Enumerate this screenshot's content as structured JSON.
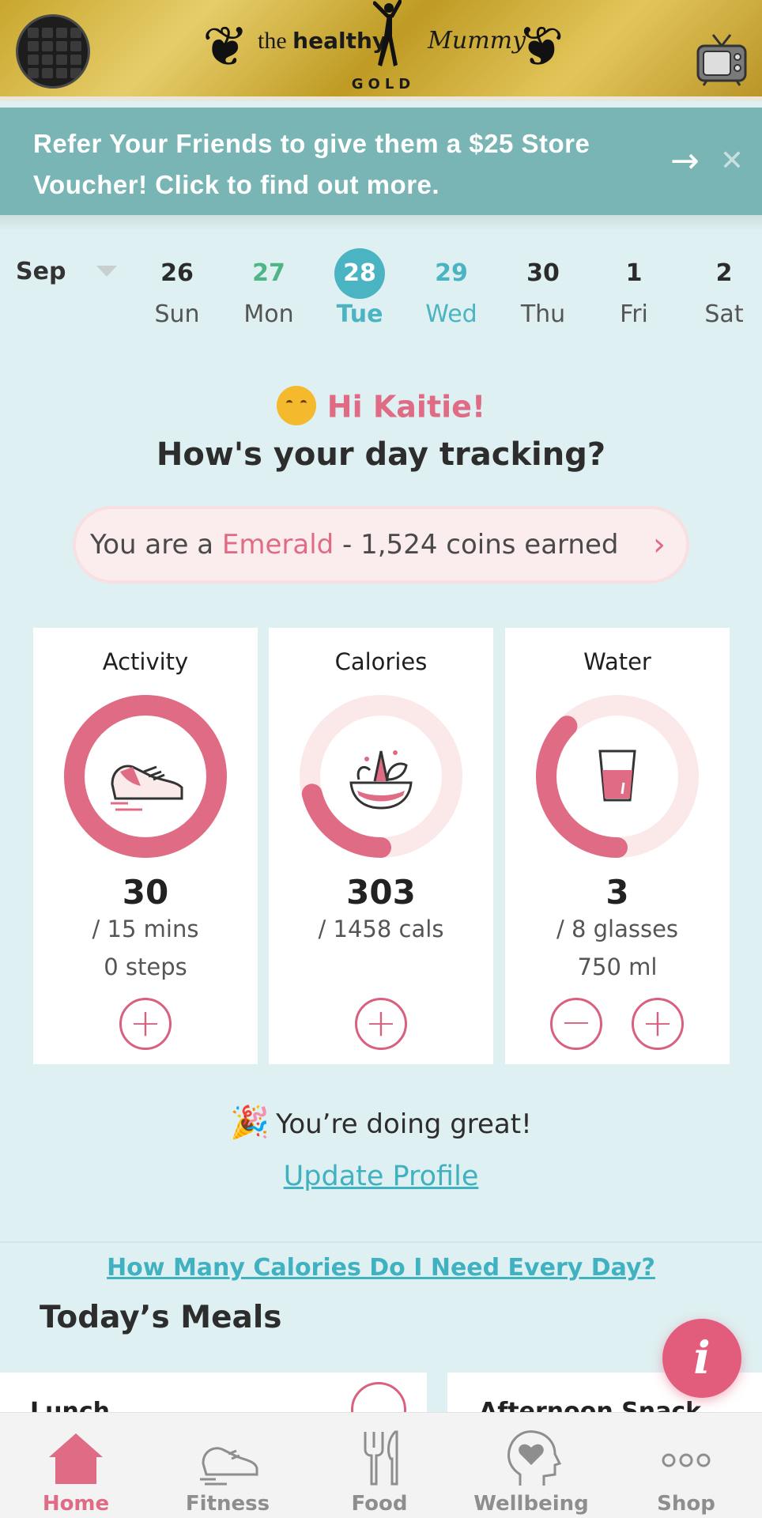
{
  "header": {
    "brand_prefix": "the",
    "brand_main": "healthy",
    "brand_script": "Mummy",
    "brand_tier": "GOLD"
  },
  "banner": {
    "text": "Refer Your Friends to give them a $25 Store Voucher! Click to find out more.",
    "arrow": "→",
    "close": "✕"
  },
  "calendar": {
    "month": "Sep",
    "days": [
      {
        "num": "26",
        "name": "Sun"
      },
      {
        "num": "27",
        "name": "Mon"
      },
      {
        "num": "28",
        "name": "Tue"
      },
      {
        "num": "29",
        "name": "Wed"
      },
      {
        "num": "30",
        "name": "Thu"
      },
      {
        "num": "1",
        "name": "Fri"
      },
      {
        "num": "2",
        "name": "Sat"
      }
    ]
  },
  "greeting": {
    "hi": "Hi Kaitie!",
    "question": "How's your day tracking?"
  },
  "rank": {
    "prefix": "You are a ",
    "level": "Emerald",
    "suffix": " - 1,524 coins earned",
    "chevron": "›"
  },
  "cards": {
    "activity": {
      "title": "Activity",
      "value": "30",
      "target": "/ 15 mins",
      "extra": "0 steps",
      "progress": 1.0
    },
    "calories": {
      "title": "Calories",
      "value": "303",
      "target": "/ 1458 cals",
      "progress": 0.21
    },
    "water": {
      "title": "Water",
      "value": "3",
      "target": "/ 8 glasses",
      "extra": "750 ml",
      "progress": 0.375
    }
  },
  "buttons": {
    "plus": "+",
    "minus": "−"
  },
  "status": {
    "text": "You’re doing great!"
  },
  "links": {
    "update_profile": "Update Profile",
    "calorie_help": "How Many Calories Do I Need Every Day?"
  },
  "meals": {
    "title": "Today’s Meals",
    "items": [
      "Lunch",
      "Afternoon Snack"
    ]
  },
  "info_button": "i",
  "tabs": [
    {
      "label": "Home",
      "icon": "home-icon"
    },
    {
      "label": "Fitness",
      "icon": "sneaker-icon"
    },
    {
      "label": "Food",
      "icon": "fork-knife-icon"
    },
    {
      "label": "Wellbeing",
      "icon": "head-heart-icon"
    },
    {
      "label": "Shop",
      "icon": "more-dots-icon"
    }
  ],
  "colors": {
    "background": "#def0f1",
    "accent_pink": "#e06b85",
    "accent_teal": "#4bb4c3",
    "banner": "#79b5b4",
    "ring_track": "#fbe9ea"
  }
}
